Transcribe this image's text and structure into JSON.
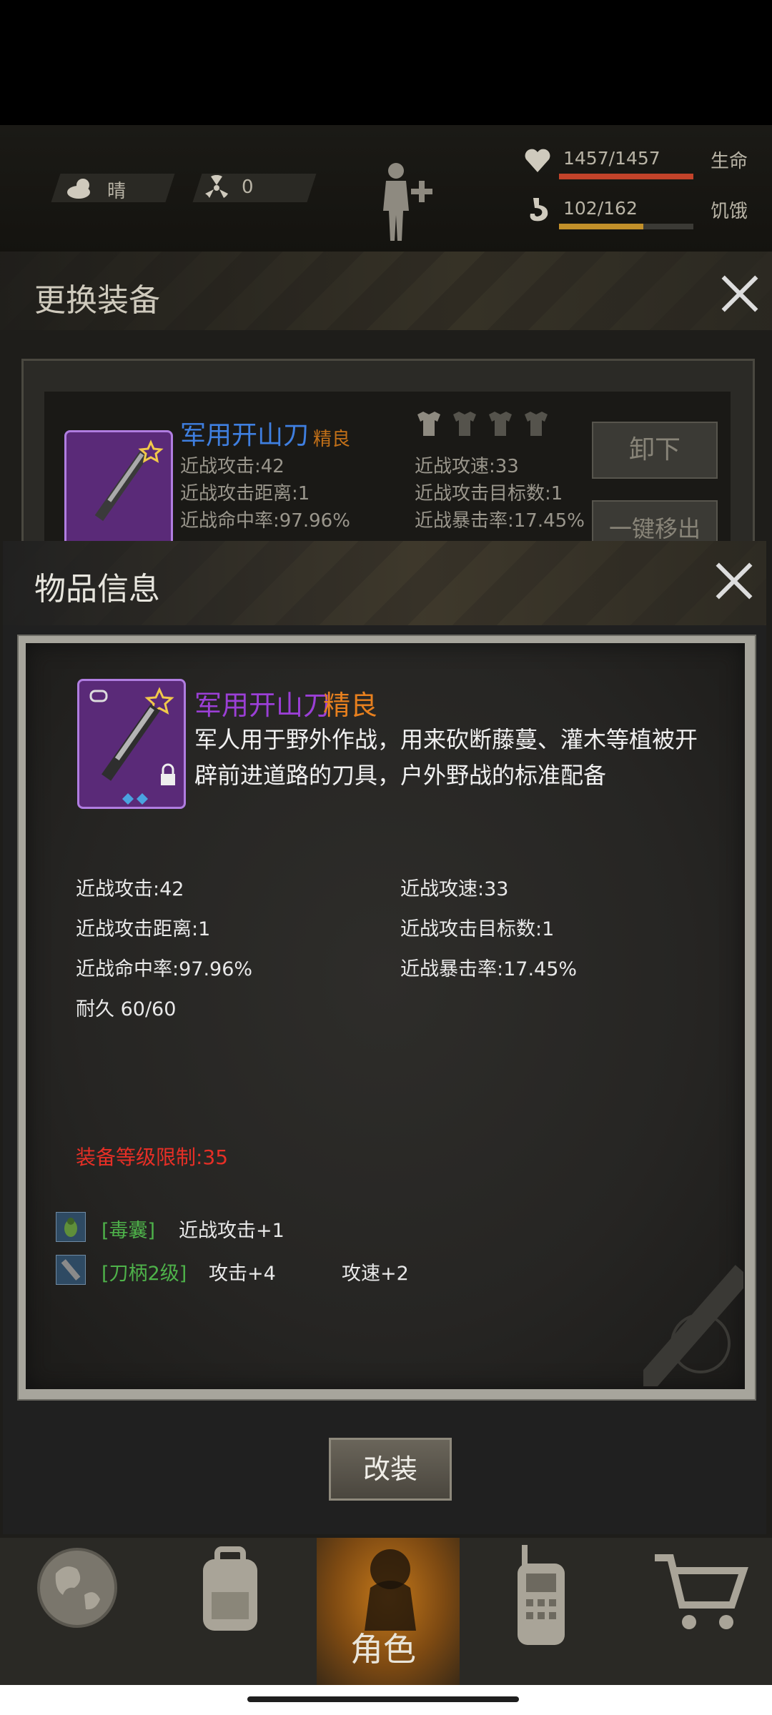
{
  "hud": {
    "weather": "晴",
    "radiation": "0",
    "health_value": "1457/1457",
    "health_label": "生命",
    "health_fraction": 1.0,
    "hunger_value": "102/162",
    "hunger_label": "饥饿",
    "hunger_fraction": 0.63
  },
  "equip_panel": {
    "title": "更换装备",
    "item_name": "军用开山刀",
    "item_quality": "精良",
    "stats": {
      "melee_attack": "近战攻击:42",
      "melee_speed": "近战攻速:33",
      "melee_range": "近战攻击距离:1",
      "melee_targets": "近战攻击目标数:1",
      "melee_hit": "近战命中率:97.96%",
      "melee_crit": "近战暴击率:17.45%"
    },
    "unequip_label": "卸下",
    "remove_all_label": "一键移出"
  },
  "item_info": {
    "title": "物品信息",
    "item_name": "军用开山刀",
    "item_quality": "精良",
    "description": "军人用于野外作战，用来砍断藤蔓、灌木等植被开辟前进道路的刀具，户外野战的标准配备",
    "stats": {
      "melee_attack": "近战攻击:42",
      "melee_speed": "近战攻速:33",
      "melee_range": "近战攻击距离:1",
      "melee_targets": "近战攻击目标数:1",
      "melee_hit": "近战命中率:97.96%",
      "melee_crit": "近战暴击率:17.45%",
      "durability": "耐久 60/60"
    },
    "level_limit": "装备等级限制:35",
    "mods": [
      {
        "name": "[毒囊]",
        "effect1": "近战攻击+1",
        "effect2": ""
      },
      {
        "name": "[刀柄2级]",
        "effect1": "攻击+4",
        "effect2": "攻速+2"
      }
    ],
    "modify_label": "改装"
  },
  "nav": {
    "active_label": "角色",
    "items": [
      "world-icon",
      "backpack-icon",
      "character-icon",
      "radio-icon",
      "cart-icon"
    ]
  },
  "colors": {
    "item_name_purple": "#9b3fd6",
    "quality_orange": "#e8801e",
    "equip_name_blue": "#3f7fe0",
    "mod_green": "#4eb24a",
    "limit_red": "#e62f26"
  }
}
